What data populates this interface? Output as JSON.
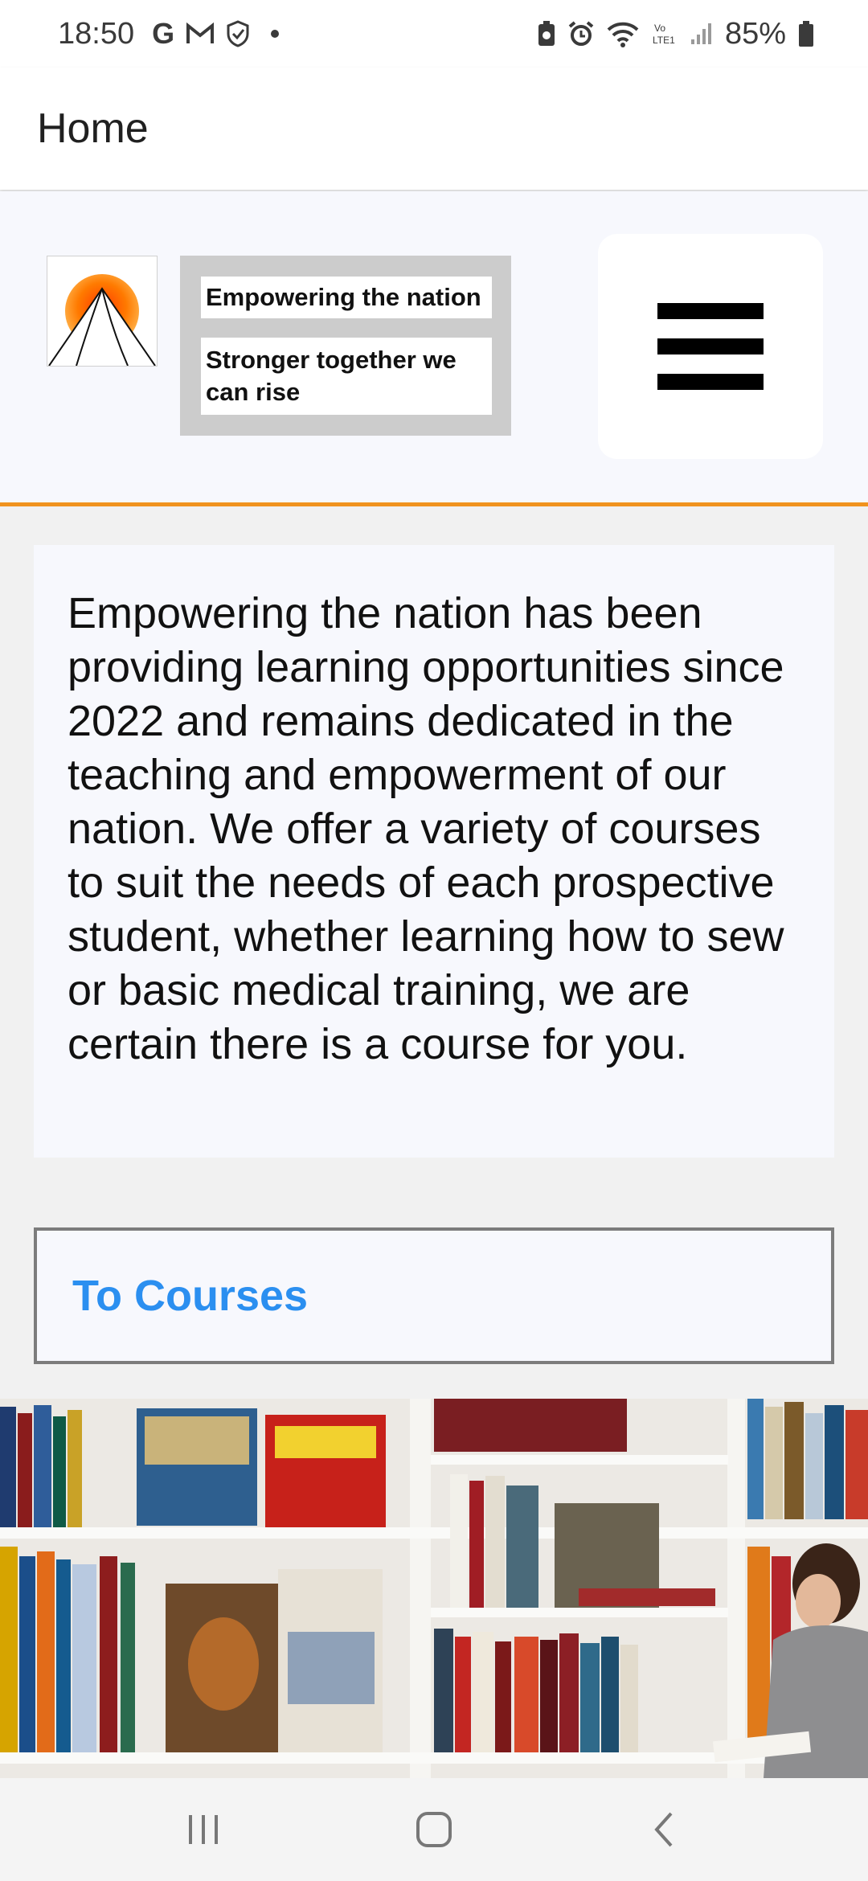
{
  "status_bar": {
    "time": "18:50",
    "notification_icons": [
      "google-icon",
      "gmail-icon",
      "shield-icon"
    ],
    "battery_percent": "85%"
  },
  "app_bar": {
    "title": "Home"
  },
  "header": {
    "logo_icon": "sunrise-mountain-logo",
    "tagline_primary": "Empowering the nation",
    "tagline_secondary": "Stronger together we can rise",
    "menu_icon": "hamburger-menu-icon"
  },
  "intro": {
    "text": "Empowering the nation has been providing learning opportunities since 2022 and remains dedicated in the teaching and empowerment of our nation. We offer a variety of courses to suit the needs of each prospective student, whether learning how to sew or basic medical training, we are certain there is a course for you."
  },
  "courses_button": {
    "label": "To Courses"
  },
  "colors": {
    "accent_orange": "#f0931e",
    "link_blue": "#2b8ff0",
    "header_bg": "#f7f8fd"
  }
}
